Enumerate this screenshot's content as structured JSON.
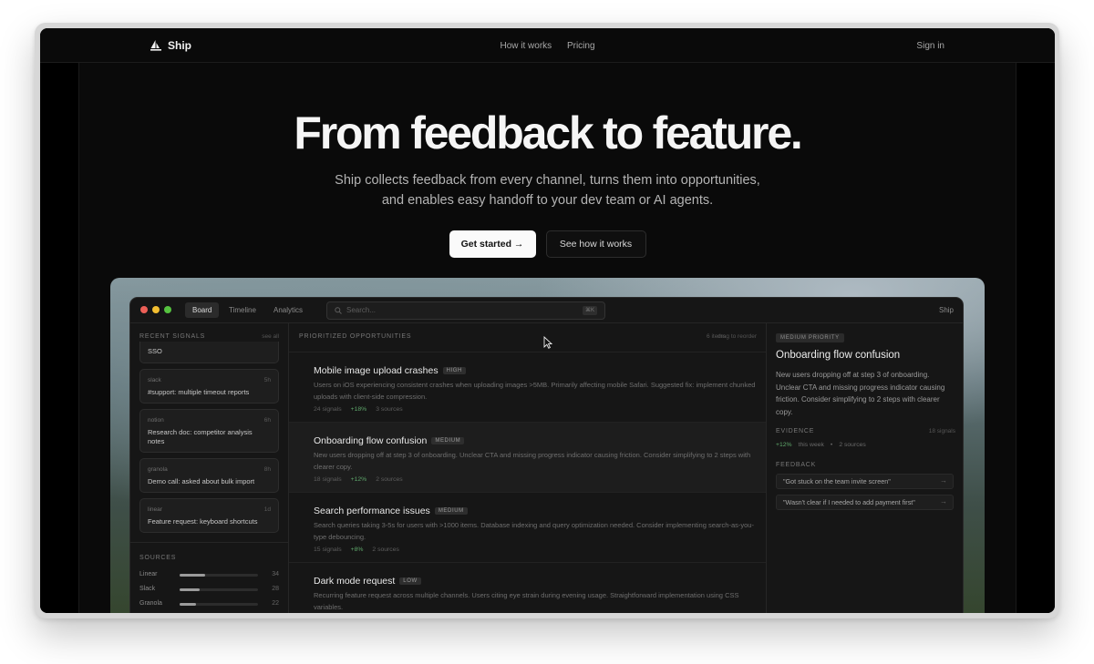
{
  "nav": {
    "brand": "Ship",
    "links": [
      "How it works",
      "Pricing"
    ],
    "sign_in": "Sign in"
  },
  "hero": {
    "title": "From feedback to feature.",
    "subtitle_line1": "Ship collects feedback from every channel, turns them into opportunities,",
    "subtitle_line2": "and enables easy handoff to your dev team or AI agents.",
    "cta_primary": "Get started →",
    "cta_secondary": "See how it works"
  },
  "app": {
    "tabs": [
      "Board",
      "Timeline",
      "Analytics"
    ],
    "active_tab": "Board",
    "search_placeholder": "Search...",
    "search_shortcut": "⌘K",
    "app_name": "Ship",
    "left": {
      "recent_label": "RECENT SIGNALS",
      "see_all": "see all",
      "partial_signal": "SSO",
      "signals": [
        {
          "source": "slack",
          "time": "5h",
          "text": "#support: multiple timeout reports"
        },
        {
          "source": "notion",
          "time": "6h",
          "text": "Research doc: competitor analysis notes"
        },
        {
          "source": "granola",
          "time": "8h",
          "text": "Demo call: asked about bulk import"
        },
        {
          "source": "linear",
          "time": "1d",
          "text": "Feature request: keyboard shortcuts"
        }
      ],
      "sources_label": "SOURCES",
      "sources": [
        {
          "name": "Linear",
          "count": "34",
          "fraction": 0.33
        },
        {
          "name": "Slack",
          "count": "28",
          "fraction": 0.26
        },
        {
          "name": "Granola",
          "count": "22",
          "fraction": 0.21
        }
      ]
    },
    "middle": {
      "label": "PRIORITIZED OPPORTUNITIES",
      "count": "6 items",
      "hint": "drag to reorder",
      "items": [
        {
          "title": "Mobile image upload crashes",
          "priority": "HIGH",
          "desc": "Users on iOS experiencing consistent crashes when uploading images >5MB. Primarily affecting mobile Safari. Suggested fix: implement chunked uploads with client-side compression.",
          "signals": "24 signals",
          "delta": "+18%",
          "sources": "3 sources"
        },
        {
          "title": "Onboarding flow confusion",
          "priority": "MEDIUM",
          "desc": "New users dropping off at step 3 of onboarding. Unclear CTA and missing progress indicator causing friction. Consider simplifying to 2 steps with clearer copy.",
          "signals": "18 signals",
          "delta": "+12%",
          "sources": "2 sources"
        },
        {
          "title": "Search performance issues",
          "priority": "MEDIUM",
          "desc": "Search queries taking 3-5s for users with >1000 items. Database indexing and query optimization needed. Consider implementing search-as-you-type debouncing.",
          "signals": "15 signals",
          "delta": "+8%",
          "sources": "2 sources"
        },
        {
          "title": "Dark mode request",
          "priority": "LOW",
          "desc": "Recurring feature request across multiple channels. Users citing eye strain during evening usage. Straightforward implementation using CSS variables.",
          "signals": "",
          "delta": "",
          "sources": ""
        }
      ]
    },
    "right": {
      "priority_pill": "MEDIUM PRIORITY",
      "title": "Onboarding flow confusion",
      "desc": "New users dropping off at step 3 of onboarding. Unclear CTA and missing progress indicator causing friction. Consider simplifying to 2 steps with clearer copy.",
      "evidence_label": "EVIDENCE",
      "evidence_count": "18 signals",
      "evidence_delta": "+12%",
      "evidence_period": "this week",
      "evidence_sep": "•",
      "evidence_sources": "2 sources",
      "feedback_label": "FEEDBACK",
      "quotes": [
        "\"Got stuck on the team invite screen\"",
        "\"Wasn't clear if I needed to add payment first\""
      ]
    }
  },
  "colors": {
    "page_bg": "#0a0a0a",
    "accent_green": "#5fa86b",
    "primary_button": "#fafafa"
  }
}
